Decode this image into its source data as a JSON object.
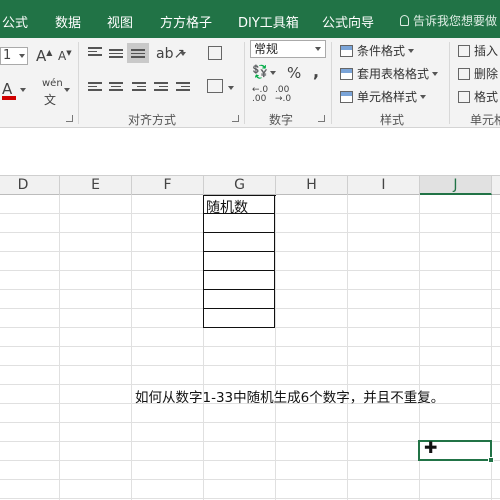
{
  "menu": {
    "items": [
      "公式",
      "数据",
      "视图",
      "方方格子",
      "DIY工具箱",
      "公式向导"
    ],
    "tell_me": "告诉我您想要做"
  },
  "ribbon": {
    "font_size": "1",
    "increase_font": "A",
    "decrease_font": "A",
    "font_color": "A",
    "phonetic": "wén",
    "groups": {
      "alignment": "对齐方式",
      "number": "数字",
      "styles": "样式",
      "cells": "单元格"
    },
    "number_format": "常规",
    "percent": "%",
    "comma": ",",
    "inc_decimal": ".00",
    "dec_decimal": ".00",
    "styles": {
      "conditional": "条件格式",
      "table": "套用表格格式",
      "cell_styles": "单元格样式"
    },
    "cells": {
      "insert": "插入",
      "delete": "删除",
      "format": "格式"
    }
  },
  "sheet": {
    "columns": [
      "D",
      "E",
      "F",
      "G",
      "H",
      "I",
      "J"
    ],
    "active_column": "J",
    "g_header": "随机数",
    "annotation": "如何从数字1-33中随机生成6个数字，并且不重复。"
  }
}
